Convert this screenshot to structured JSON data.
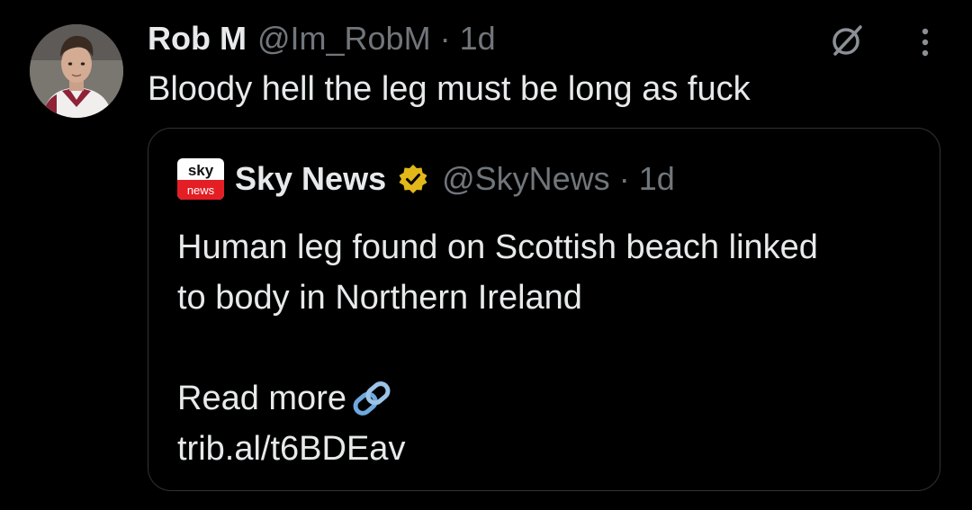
{
  "tweet": {
    "display_name": "Rob M",
    "handle": "@Im_RobM",
    "separator": "·",
    "time": "1d",
    "text": "Bloody hell the leg must be long as fuck",
    "avatar_icon": "user-avatar-photo",
    "grok_icon": "grok-icon",
    "more_icon": "more-vertical-icon"
  },
  "quoted_tweet": {
    "logo_text_top": "sky",
    "logo_text_bottom": "news",
    "display_name": "Sky News",
    "verified_icon": "verified-badge-gold-icon",
    "handle": "@SkyNews",
    "separator": "·",
    "time": "1d",
    "text_line1": "Human leg found on Scottish beach linked",
    "text_line2": "to body in Northern Ireland",
    "read_more": "Read more",
    "link_emoji_icon": "link-icon",
    "url": "trib.al/t6BDEav"
  },
  "colors": {
    "background": "#000000",
    "text_primary": "#e7e9ea",
    "text_secondary": "#71767b",
    "border": "#2f3336",
    "verified_gold": "#e2b719",
    "sky_red": "#e31e24",
    "link_emoji_blue": "#6fa8dc"
  }
}
